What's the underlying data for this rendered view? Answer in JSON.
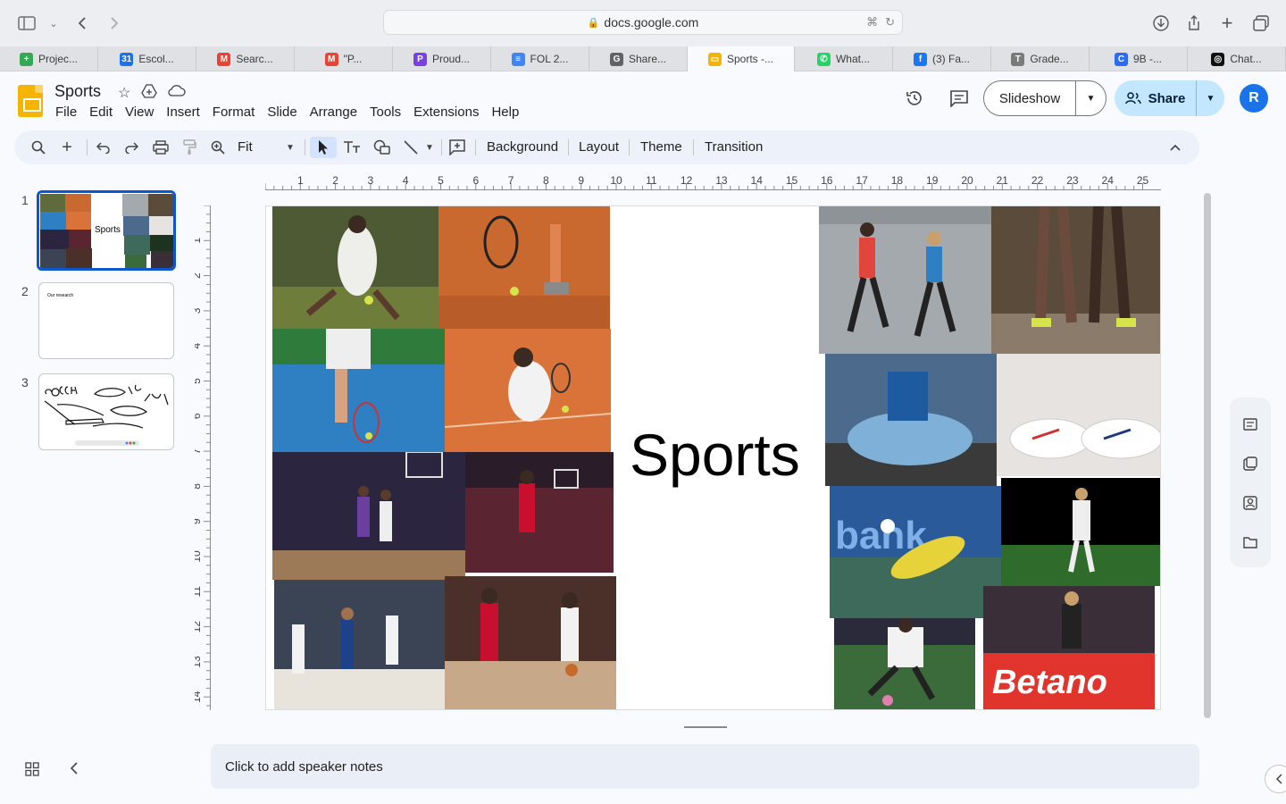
{
  "browser": {
    "url": "docs.google.com",
    "tabs": [
      {
        "label": "Projec...",
        "icon_color": "#34a853",
        "icon_char": "+"
      },
      {
        "label": "Escol...",
        "icon_color": "#1a73e8",
        "icon_char": "31"
      },
      {
        "label": "Searc...",
        "icon_color": "#ea4335",
        "icon_char": "M"
      },
      {
        "label": "\"P...",
        "icon_color": "#ea4335",
        "icon_char": "M"
      },
      {
        "label": "Proud...",
        "icon_color": "#7b3fe4",
        "icon_char": "P"
      },
      {
        "label": "FOL 2...",
        "icon_color": "#4285f4",
        "icon_char": "≡"
      },
      {
        "label": "Share...",
        "icon_color": "#5f6368",
        "icon_char": "G"
      },
      {
        "label": "Sports -...",
        "icon_color": "#f4b400",
        "icon_char": "▭",
        "active": true
      },
      {
        "label": "What...",
        "icon_color": "#25d366",
        "icon_char": "✆"
      },
      {
        "label": "(3) Fa...",
        "icon_color": "#1877f2",
        "icon_char": "f"
      },
      {
        "label": "Grade...",
        "icon_color": "#7a7a7a",
        "icon_char": "T"
      },
      {
        "label": "9B -...",
        "icon_color": "#2a6df4",
        "icon_char": "C"
      },
      {
        "label": "Chat...",
        "icon_color": "#111111",
        "icon_char": "◎"
      }
    ]
  },
  "app": {
    "title": "Sports",
    "menu": [
      "File",
      "Edit",
      "View",
      "Insert",
      "Format",
      "Slide",
      "Arrange",
      "Tools",
      "Extensions",
      "Help"
    ],
    "slideshow_label": "Slideshow",
    "share_label": "Share",
    "avatar_letter": "R"
  },
  "toolbar": {
    "zoom_label": "Fit",
    "background_label": "Background",
    "layout_label": "Layout",
    "theme_label": "Theme",
    "transition_label": "Transition"
  },
  "ruler": {
    "h_labels": [
      "1",
      "2",
      "3",
      "4",
      "5",
      "6",
      "7",
      "8",
      "9",
      "10",
      "11",
      "12",
      "13",
      "14",
      "15",
      "16",
      "17",
      "18",
      "19",
      "20",
      "21",
      "22",
      "23",
      "24",
      "25"
    ],
    "v_labels": [
      "1",
      "2",
      "3",
      "4",
      "5",
      "6",
      "7",
      "8",
      "9",
      "10",
      "11",
      "12",
      "13",
      "14"
    ]
  },
  "filmstrip": [
    {
      "number": "1",
      "text": "Sports"
    },
    {
      "number": "2",
      "text": "Our research"
    },
    {
      "number": "3",
      "text": ""
    }
  ],
  "slide": {
    "title": "Sports"
  },
  "notes_placeholder": "Click to add speaker notes"
}
